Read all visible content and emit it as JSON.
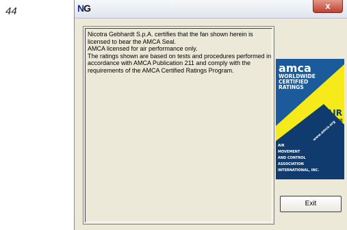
{
  "page_number": "44",
  "window": {
    "title_left": "N",
    "title_right": "G",
    "close_label": "x"
  },
  "certification_text": "Nicotra Gebhardt S.p.A. certifies that the fan shown herein is licensed to bear the AMCA Seal.\nAMCA licensed for air performance only.\nThe ratings shown are based on tests and procedures performed in accordance with AMCA Publication 211 and comply with the requirements of the AMCA Certified Ratings Program.",
  "logo": {
    "brand": "amca",
    "line1": "WORLDWIDE",
    "line2": "CERTIFIED",
    "line3": "RATINGS",
    "air": "AIR",
    "performance": "PERFORMANCE",
    "assoc1": "AIR",
    "assoc2": "MOVEMENT",
    "assoc3": "AND CONTROL",
    "assoc4": "ASSOCIATION",
    "assoc5": "INTERNATIONAL, INC.",
    "website": "www.amca.org",
    "colors": {
      "blue": "#1b5a9b",
      "yellow": "#f6ea1a",
      "navy": "#0f3b6e"
    }
  },
  "buttons": {
    "exit": "Exit"
  }
}
